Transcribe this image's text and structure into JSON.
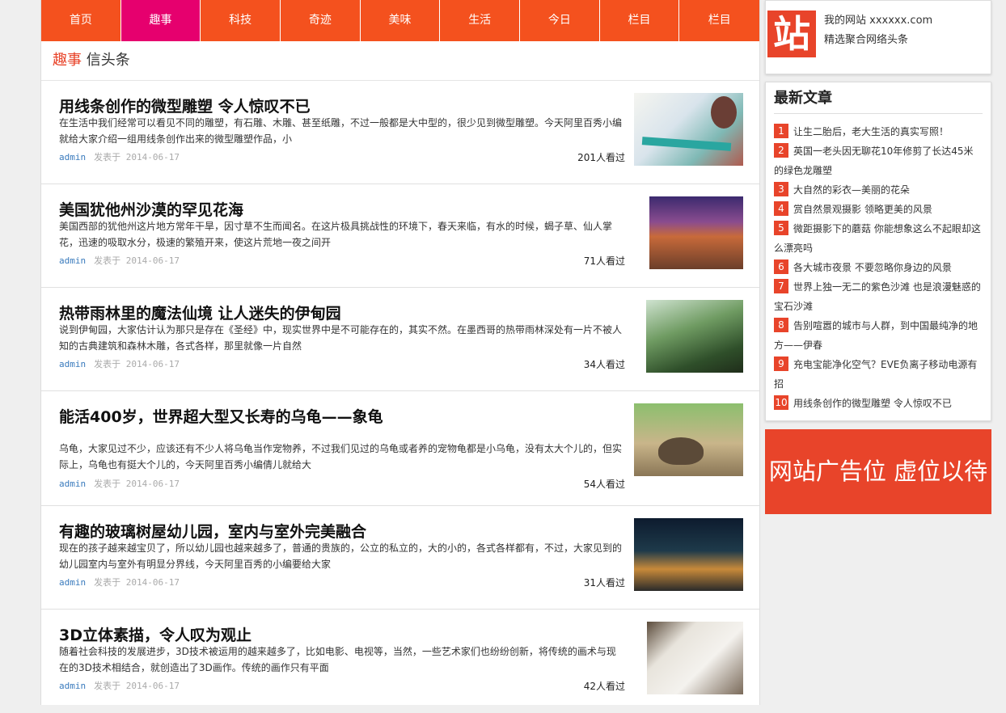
{
  "nav": [
    {
      "label": "首页",
      "active": false
    },
    {
      "label": "趣事",
      "active": true
    },
    {
      "label": "科技",
      "active": false
    },
    {
      "label": "奇迹",
      "active": false
    },
    {
      "label": "美味",
      "active": false
    },
    {
      "label": "生活",
      "active": false
    },
    {
      "label": "今日",
      "active": false
    },
    {
      "label": "栏目",
      "active": false
    },
    {
      "label": "栏目",
      "active": false
    }
  ],
  "breadcrumb": {
    "category": "趣事",
    "sub": "信头条"
  },
  "articles": [
    {
      "title": "用线条创作的微型雕塑 令人惊叹不已",
      "desc": "在生活中我们经常可以看见不同的雕塑，有石雕、木雕、甚至纸雕，不过一般都是大中型的，很少见到微型雕塑。今天阿里百秀小编就给大家介绍一组用线条创作出来的微型雕塑作品，小",
      "author": "admin",
      "posted": "发表于 2014-06-17",
      "views": "201人看过"
    },
    {
      "title": "美国犹他州沙漠的罕见花海",
      "desc": "美国西部的犹他州这片地方常年干旱，因寸草不生而闻名。在这片极具挑战性的环境下，春天来临，有水的时候，蝎子草、仙人掌花，迅速的吸取水分，极速的繁殖开来，使这片荒地一夜之间开",
      "author": "admin",
      "posted": "发表于 2014-06-17",
      "views": "71人看过"
    },
    {
      "title": "热带雨林里的魔法仙境 让人迷失的伊甸园",
      "desc": "说到伊甸园，大家估计认为那只是存在《圣经》中，现实世界中是不可能存在的，其实不然。在墨西哥的热带雨林深处有一片不被人知的古典建筑和森林木雕，各式各样，那里就像一片自然",
      "author": "admin",
      "posted": "发表于 2014-06-17",
      "views": "34人看过"
    },
    {
      "title": "能活400岁，世界超大型又长寿的乌龟——象龟",
      "desc": "乌龟，大家见过不少，应该还有不少人将乌龟当作宠物养，不过我们见过的乌龟或者养的宠物龟都是小乌龟，没有太大个儿的，但实际上，乌龟也有挺大个儿的，今天阿里百秀小编倩儿就给大",
      "author": "admin",
      "posted": "发表于 2014-06-17",
      "views": "54人看过"
    },
    {
      "title": "有趣的玻璃树屋幼儿园，室内与室外完美融合",
      "desc": "现在的孩子越来越宝贝了，所以幼儿园也越来越多了，普通的贵族的，公立的私立的，大的小的，各式各样都有，不过，大家见到的幼儿园室内与室外有明显分界线，今天阿里百秀的小编要给大家",
      "author": "admin",
      "posted": "发表于 2014-06-17",
      "views": "31人看过"
    },
    {
      "title": "3D立体素描，令人叹为观止",
      "desc": "随着社会科技的发展进步，3D技术被运用的越来越多了，比如电影、电视等，当然，一些艺术家们也纷纷创新，将传统的画术与现在的3D技术相结合，就创造出了3D画作。传统的画作只有平面",
      "author": "admin",
      "posted": "发表于 2014-06-17",
      "views": "42人看过"
    }
  ],
  "sidebar": {
    "logo_char": "站",
    "site_name": "我的网站 xxxxxx.com",
    "site_slogan": "精选聚合网络头条",
    "latest_title": "最新文章",
    "latest": [
      {
        "num": "1",
        "text": "让生二胎后，老大生活的真实写照！"
      },
      {
        "num": "2",
        "text": "英国一老头因无聊花10年修剪了长达45米的绿色龙雕塑"
      },
      {
        "num": "3",
        "text": "大自然的彩衣—美丽的花朵"
      },
      {
        "num": "4",
        "text": "赏自然景观摄影 领略更美的风景"
      },
      {
        "num": "5",
        "text": "微距摄影下的蘑菇 你能想象这么不起眼却这么漂亮吗"
      },
      {
        "num": "6",
        "text": "各大城市夜景 不要忽略你身边的风景"
      },
      {
        "num": "7",
        "text": "世界上独一无二的紫色沙滩 也是浪漫魅惑的宝石沙滩"
      },
      {
        "num": "8",
        "text": "告别喧嚣的城市与人群，到中国最纯净的地方——伊春"
      },
      {
        "num": "9",
        "text": "充电宝能净化空气？EVE负离子移动电源有招"
      },
      {
        "num": "10",
        "text": "用线条创作的微型雕塑 令人惊叹不已"
      }
    ],
    "ad_text": "网站广告位 虚位以待"
  },
  "colors": {
    "nav": "#f4511e",
    "nav_active": "#e6006e",
    "accent": "#e8442a"
  },
  "icons": {
    "logo": "logo-icon"
  }
}
